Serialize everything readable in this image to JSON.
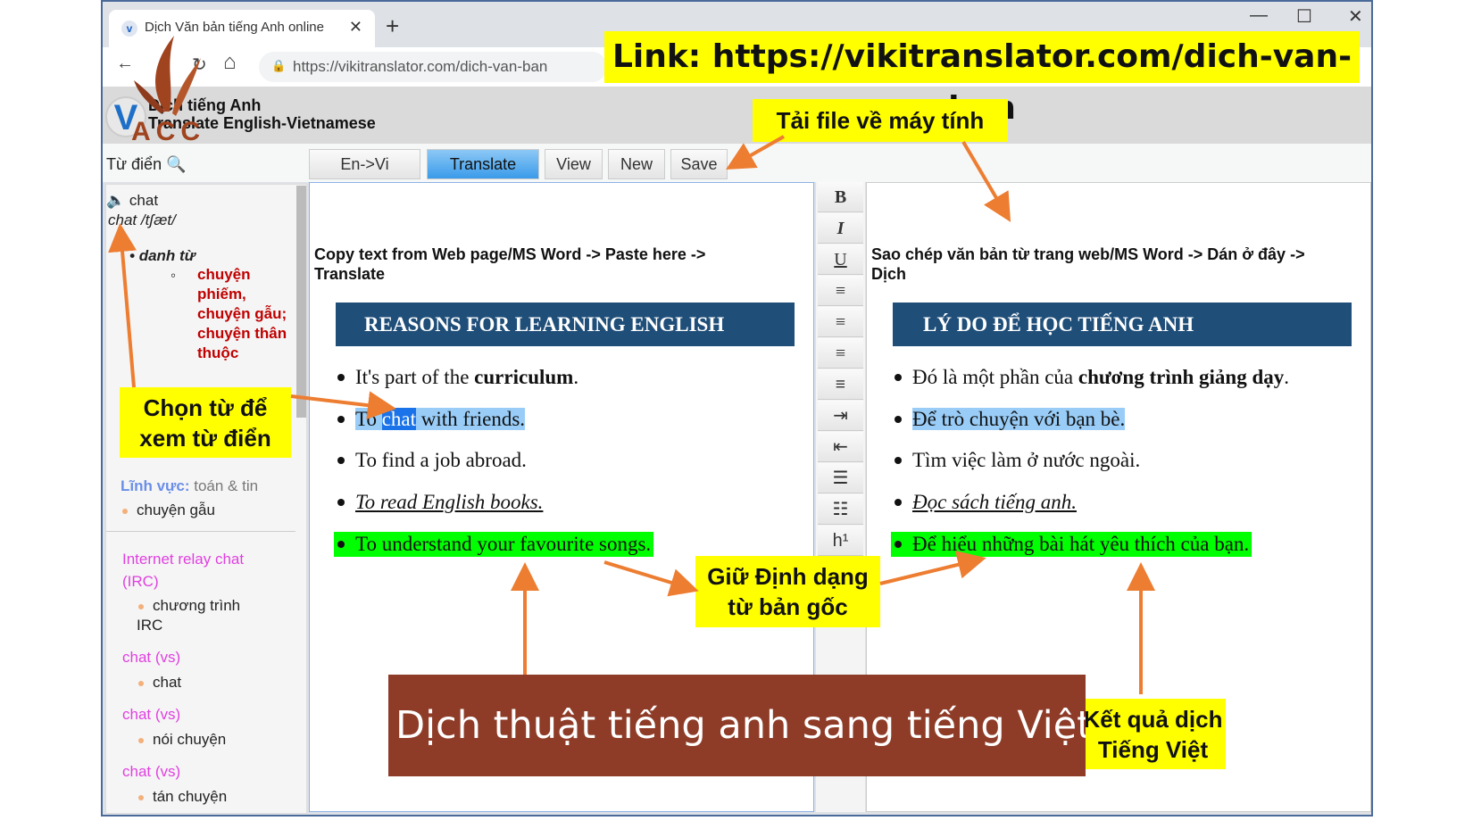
{
  "browser": {
    "tab_title": "Dịch Văn bản tiếng Anh online",
    "tab_close": "✕",
    "new_tab": "+",
    "url": "https://vikitranslator.com/dich-van-ban",
    "back": "←",
    "reload": "↻",
    "home": "⌂",
    "minimize": "—",
    "maximize": "☐",
    "close": "✕"
  },
  "site": {
    "title": "Dịch tiếng Anh",
    "subtitle": "Translate English-Vietnamese",
    "logo_letter": "V"
  },
  "toolbar": {
    "dictionary": "Từ điển",
    "buttons": [
      "En->Vi",
      "Translate",
      "View",
      "New",
      "Save"
    ],
    "active": "Translate"
  },
  "format_buttons": [
    "B",
    "I",
    "U",
    "≡",
    "≡",
    "≡",
    "≡",
    "⇥",
    "⇤",
    "☰",
    "☷",
    "h¹"
  ],
  "dictionary": {
    "word": "chat",
    "phonetic": "chat /tʃæt/",
    "pos": "danh từ",
    "meanings": [
      "chuyện",
      "phiếm,",
      "chuyện gẫu;",
      "chuyện thân",
      "thuộc"
    ],
    "field_label": "Lĩnh vực:",
    "field_value": "toán & tin",
    "field_meaning": "chuyện gẫu",
    "entries": [
      {
        "term": "Internet relay chat",
        "term2": "(IRC)",
        "meaning": "chương trình",
        "meaning2": "IRC"
      },
      {
        "term": "chat (vs)",
        "meaning": "chat"
      },
      {
        "term": "chat (vs)",
        "meaning": "nói chuyện"
      },
      {
        "term": "chat (vs)",
        "meaning": "tán chuyện"
      }
    ]
  },
  "source": {
    "instruction": "Copy text from Web page/MS Word -> Paste here ->",
    "instruction2": "Translate",
    "heading": "REASONS FOR LEARNING ENGLISH",
    "items": {
      "i1a": "It's part of the ",
      "i1b": "curriculum",
      "i1c": ".",
      "i2a": "To ",
      "i2b": "chat",
      "i2c": " with friends.",
      "i3": "To find a job abroad.",
      "i4": "To read English books.",
      "i5": "To understand your favourite songs."
    }
  },
  "target": {
    "instruction": "Sao chép văn bản từ trang web/MS Word -> Dán ở đây ->",
    "instruction2": "Dịch",
    "heading": "LÝ DO ĐỂ HỌC TIẾNG ANH",
    "items": {
      "i1a": "Đó là một phần của ",
      "i1b": "chương trình giảng dạy",
      "i1c": ".",
      "i2": "Để trò chuyện với bạn bè.",
      "i3": "Tìm việc làm ở nước ngoài.",
      "i4": "Đọc sách tiếng anh.",
      "i5": "Để hiểu những bài hát yêu thích của bạn."
    }
  },
  "annotations": {
    "link": "Link: https://vikitranslator.com/dich-van-ban",
    "download": "Tải file về máy tính",
    "choose1": "Chọn từ để",
    "choose2": "xem từ điển",
    "keep1": "Giữ Định dạng",
    "keep2": "từ bản gốc",
    "result1": "Kết quả dịch",
    "result2": "Tiếng Việt",
    "banner": "Dịch thuật tiếng anh sang tiếng Việt",
    "logo": "VACC"
  },
  "colors": {
    "highlight_yellow": "#ffff00",
    "arrow": "#ed7d31",
    "heading_bg": "#1f4e79",
    "banner_bg": "#8e3c28",
    "green_highlight": "#00ff00",
    "blue_highlight": "#99cdf8"
  }
}
